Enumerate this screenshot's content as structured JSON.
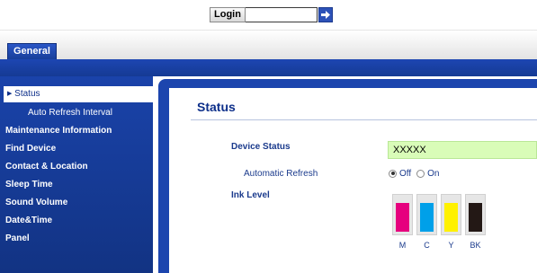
{
  "login": {
    "label": "Login",
    "value": "",
    "go_icon": "arrow-right-icon"
  },
  "tabs": [
    {
      "label": "General"
    }
  ],
  "sidebar": {
    "items": [
      {
        "label": "Status",
        "active": true,
        "icon": "triangle-right-icon"
      },
      {
        "label": "Auto Refresh Interval",
        "sub": true
      },
      {
        "label": "Maintenance Information"
      },
      {
        "label": "Find Device"
      },
      {
        "label": "Contact & Location"
      },
      {
        "label": "Sleep Time"
      },
      {
        "label": "Sound Volume"
      },
      {
        "label": "Date&Time"
      },
      {
        "label": "Panel"
      }
    ]
  },
  "main": {
    "title": "Status",
    "device_status": {
      "label": "Device Status",
      "value": "XXXXX"
    },
    "auto_refresh": {
      "label": "Automatic Refresh",
      "options": [
        {
          "label": "Off",
          "checked": true
        },
        {
          "label": "On",
          "checked": false
        }
      ]
    },
    "ink_level": {
      "label": "Ink Level",
      "inks": [
        {
          "label": "M",
          "color": "#e6007e",
          "level": 0.8
        },
        {
          "label": "C",
          "color": "#00a0e9",
          "level": 0.8
        },
        {
          "label": "Y",
          "color": "#fff100",
          "level": 0.8
        },
        {
          "label": "BK",
          "color": "#231815",
          "level": 0.8
        }
      ]
    }
  },
  "colors": {
    "nav_blue": "#1a43aa",
    "title_blue": "#0d2f8a",
    "status_green": "#d9fcb8"
  }
}
